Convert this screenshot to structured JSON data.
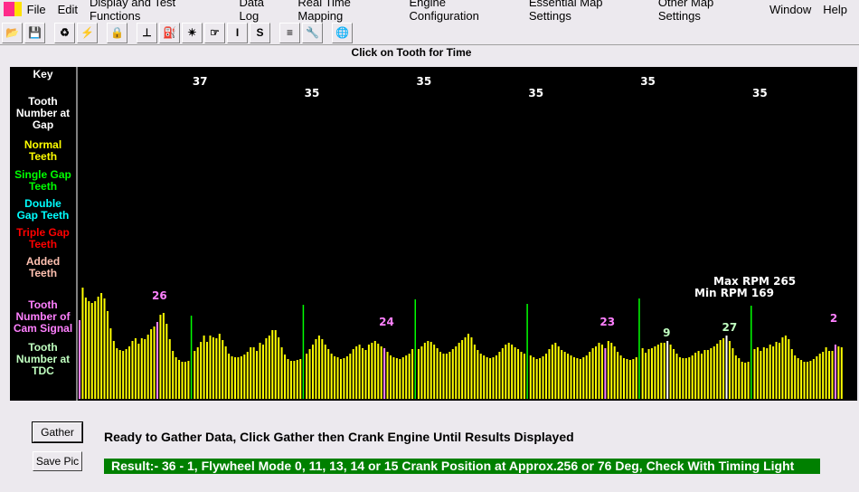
{
  "menu": [
    "File",
    "Edit",
    "Display and Test Functions",
    "Data Log",
    "Real Time Mapping",
    "Engine Configuration",
    "Essential Map Settings",
    "Other Map Settings",
    "Window",
    "Help"
  ],
  "toolbar": [
    {
      "icon": "open-folder-icon",
      "glyph": "📂"
    },
    {
      "icon": "save-disk-icon",
      "glyph": "💾"
    },
    {
      "icon": "refresh-icon",
      "glyph": "♻"
    },
    {
      "icon": "lightning-icon",
      "glyph": "⚡"
    },
    {
      "icon": "lock-icon",
      "glyph": "🔒"
    },
    {
      "icon": "injector-icon",
      "glyph": "⊥"
    },
    {
      "icon": "fuel-can-icon",
      "glyph": "⛽"
    },
    {
      "icon": "spark-icon",
      "glyph": "✴"
    },
    {
      "icon": "throttle-icon",
      "glyph": "☞"
    },
    {
      "icon": "i-icon",
      "glyph": "I"
    },
    {
      "icon": "s-icon",
      "glyph": "S"
    },
    {
      "icon": "chart-bars-icon",
      "glyph": "≡"
    },
    {
      "icon": "wrench-icon",
      "glyph": "🔧"
    },
    {
      "icon": "globe-icon",
      "glyph": "🌐"
    }
  ],
  "caption": "Click on Tooth for Time",
  "key": {
    "title": "Key",
    "items": [
      {
        "label": "Tooth Number at Gap",
        "color": "#ffffff"
      },
      {
        "label": "Normal Teeth",
        "color": "#ffff00"
      },
      {
        "label": "Single Gap Teeth",
        "color": "#00ff00"
      },
      {
        "label": "Double Gap Teeth",
        "color": "#00ffff"
      },
      {
        "label": "Triple Gap Teeth",
        "color": "#ff0000"
      },
      {
        "label": "Added Teeth",
        "color": "#ffc0b0"
      },
      {
        "label": "Tooth Number of Cam Signal",
        "color": "#ff80ff"
      },
      {
        "label": "Tooth Number at TDC",
        "color": "#c0ffc0"
      }
    ]
  },
  "chart_data": {
    "type": "bar",
    "colors": {
      "normal": "#ffff00",
      "gap": "#00ff00",
      "cam": "#ff80ff",
      "tdc": "#ffffff"
    },
    "values": [
      87,
      123,
      112,
      108,
      106,
      108,
      113,
      117,
      111,
      97,
      78,
      64,
      56,
      54,
      53,
      55,
      58,
      64,
      67,
      61,
      67,
      66,
      71,
      77,
      80,
      85,
      93,
      95,
      83,
      66,
      53,
      46,
      43,
      41,
      41,
      42,
      92,
      53,
      57,
      63,
      70,
      63,
      70,
      68,
      67,
      72,
      65,
      58,
      50,
      47,
      46,
      46,
      47,
      49,
      52,
      57,
      57,
      53,
      62,
      60,
      67,
      70,
      76,
      76,
      68,
      57,
      49,
      44,
      42,
      42,
      43,
      44,
      104,
      50,
      55,
      60,
      66,
      70,
      66,
      60,
      55,
      50,
      47,
      46,
      44,
      45,
      47,
      50,
      55,
      58,
      60,
      56,
      54,
      60,
      62,
      64,
      61,
      58,
      56,
      52,
      48,
      46,
      45,
      44,
      46,
      48,
      50,
      55,
      110,
      55,
      58,
      62,
      64,
      63,
      60,
      56,
      52,
      50,
      50,
      52,
      55,
      58,
      62,
      65,
      68,
      72,
      68,
      60,
      54,
      50,
      48,
      46,
      45,
      46,
      48,
      52,
      56,
      60,
      62,
      60,
      57,
      55,
      52,
      50,
      105,
      48,
      46,
      44,
      45,
      47,
      50,
      55,
      60,
      62,
      58,
      54,
      52,
      50,
      48,
      46,
      45,
      44,
      46,
      48,
      52,
      56,
      58,
      62,
      60,
      56,
      64,
      62,
      58,
      52,
      48,
      45,
      44,
      43,
      44,
      46,
      111,
      56,
      51,
      55,
      56,
      58,
      60,
      62,
      62,
      64,
      60,
      55,
      50,
      46,
      45,
      45,
      46,
      48,
      51,
      53,
      50,
      54,
      54,
      56,
      58,
      61,
      65,
      67,
      70,
      64,
      56,
      48,
      45,
      41,
      40,
      41,
      103,
      55,
      57,
      53,
      57,
      56,
      60,
      58,
      63,
      62,
      68,
      70,
      66,
      55,
      48,
      45,
      43,
      41,
      41,
      42,
      44,
      47,
      50,
      52,
      57,
      53,
      53,
      60,
      58,
      57
    ],
    "gap_indices": [
      36,
      72,
      108,
      144,
      180,
      216
    ],
    "cam_indices": [
      0,
      25,
      98,
      169,
      243
    ],
    "tdc_indices": [
      189,
      208
    ],
    "gap_labels": [
      {
        "index": 36,
        "text": "37"
      },
      {
        "index": 72,
        "text": "35"
      },
      {
        "index": 108,
        "text": "35"
      },
      {
        "index": 144,
        "text": "35"
      },
      {
        "index": 180,
        "text": "35"
      },
      {
        "index": 216,
        "text": "35"
      }
    ],
    "cam_labels": [
      {
        "index": 25,
        "text": "26"
      },
      {
        "index": 98,
        "text": "24"
      },
      {
        "index": 169,
        "text": "23"
      },
      {
        "index": 243,
        "text": "2"
      }
    ],
    "tdc_labels": [
      {
        "index": 189,
        "text": "9"
      },
      {
        "index": 208,
        "text": "27"
      }
    ],
    "max_rpm": "Max RPM 265",
    "min_rpm": "Min RPM 169"
  },
  "buttons": {
    "gather": "Gather",
    "save_pic": "Save Pic"
  },
  "status": "Ready to Gather Data, Click Gather then Crank Engine Until Results Displayed",
  "result": "Result:-  36 -  1, Flywheel Mode 0, 11, 13, 14 or 15 Crank Position at Approx.256 or 76 Deg, Check With Timing Light"
}
